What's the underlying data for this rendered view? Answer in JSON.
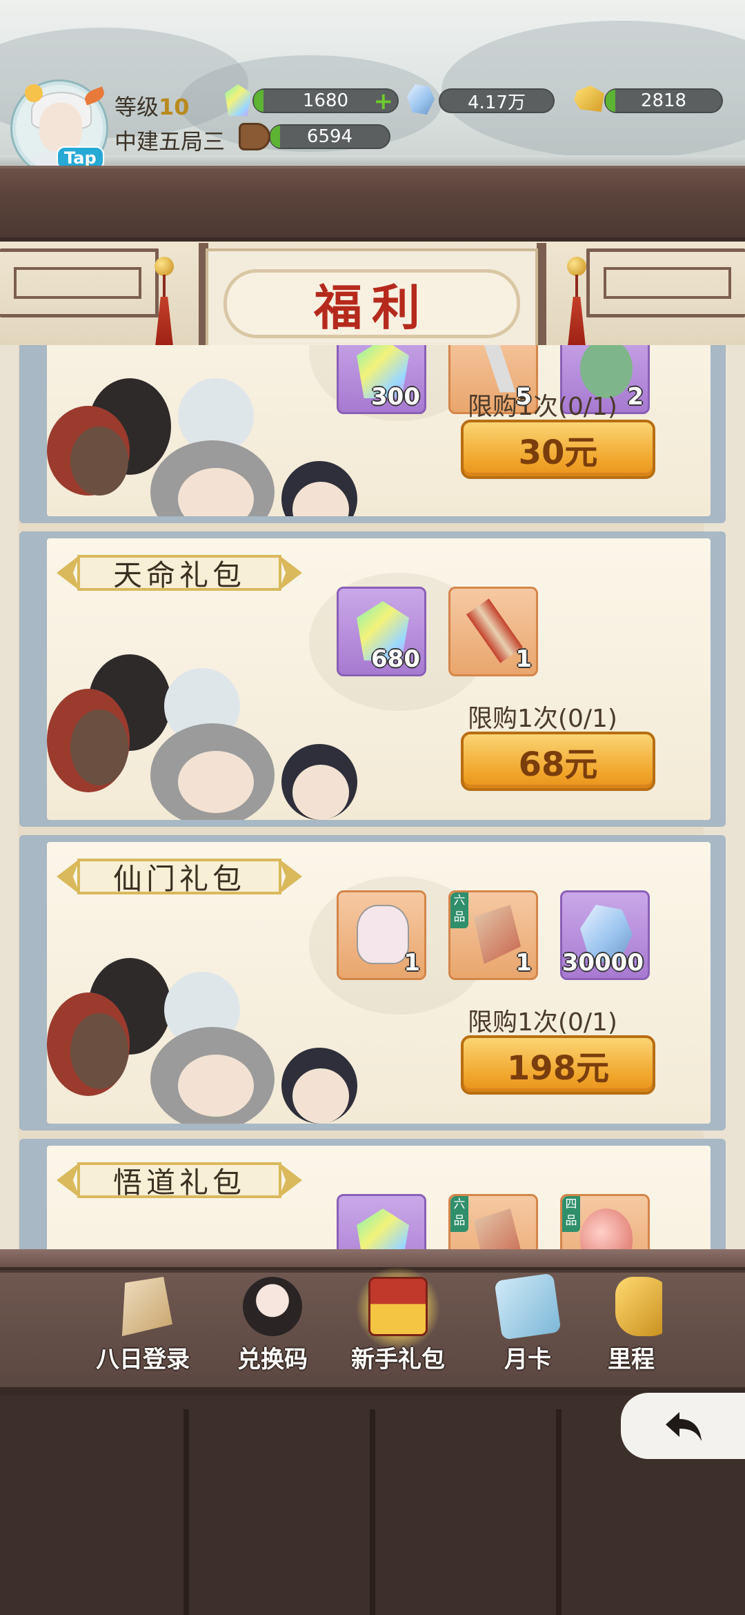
{
  "header": {
    "level_label": "等级",
    "level_value": "10",
    "player_name": "中建五局三",
    "avatar_tag": "Tap"
  },
  "resources": {
    "gems": "1680",
    "crystals": "4.17万",
    "gold": "2818",
    "wood": "6594"
  },
  "page_title": "福利",
  "packs": [
    {
      "name": "",
      "items": [
        {
          "icon": "gem-icon",
          "count": "300",
          "rarity": "purple"
        },
        {
          "icon": "key-icon",
          "count": "5",
          "rarity": "orange"
        },
        {
          "icon": "jade-icon",
          "count": "2",
          "rarity": "purple"
        }
      ],
      "limit": "限购1次(0/1)",
      "price": "30元"
    },
    {
      "name": "天命礼包",
      "items": [
        {
          "icon": "gem-icon",
          "count": "680",
          "rarity": "purple"
        },
        {
          "icon": "scroll-icon",
          "count": "1",
          "rarity": "orange"
        }
      ],
      "limit": "限购1次(0/1)",
      "price": "68元"
    },
    {
      "name": "仙门礼包",
      "items": [
        {
          "icon": "fox-disciple-icon",
          "count": "1",
          "rarity": "orange"
        },
        {
          "icon": "technique-scroll-icon",
          "count": "1",
          "rarity": "orange",
          "grade": "六品"
        },
        {
          "icon": "crystal-icon",
          "count": "30000",
          "rarity": "purple"
        }
      ],
      "limit": "限购1次(0/1)",
      "price": "198元"
    },
    {
      "name": "悟道礼包",
      "items": [
        {
          "icon": "gem-icon",
          "count": "",
          "rarity": "purple"
        },
        {
          "icon": "technique-scroll-icon",
          "count": "",
          "rarity": "orange",
          "grade": "六品"
        },
        {
          "icon": "peach-icon",
          "count": "",
          "rarity": "orange",
          "grade": "四品"
        }
      ]
    }
  ],
  "nav": [
    {
      "label": "八日登录",
      "icon": "scroll-login-icon"
    },
    {
      "label": "兑换码",
      "icon": "girl-code-icon"
    },
    {
      "label": "新手礼包",
      "icon": "treasure-chest-icon",
      "active": true
    },
    {
      "label": "月卡",
      "icon": "month-card-icon"
    },
    {
      "label": "里程",
      "icon": "golden-beast-icon"
    }
  ],
  "colors": {
    "price_button": "#f1a62c",
    "title_red": "#b52a1c",
    "resource_fill": "#5cb334"
  }
}
